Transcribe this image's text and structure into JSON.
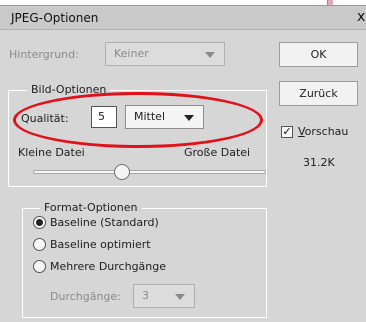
{
  "window": {
    "title": "JPEG-Optionen",
    "close_glyph": "x"
  },
  "hintergrund": {
    "label": "Hintergrund:",
    "value": "Keiner"
  },
  "buttons": {
    "ok": "OK",
    "back": "Zurück"
  },
  "preview": {
    "label_first": "V",
    "label_rest": "orschau",
    "checked": true,
    "size": "31.2K"
  },
  "bild_optionen": {
    "legend": "Bild-Optionen",
    "quality_label": "Qualität:",
    "quality_value": "5",
    "quality_preset": "Mittel",
    "slider_min_label": "Kleine Datei",
    "slider_max_label": "Große Datei"
  },
  "format_optionen": {
    "legend": "Format-Optionen",
    "options": [
      {
        "label": "Baseline (Standard)",
        "selected": true
      },
      {
        "label": "Baseline optimiert",
        "selected": false
      },
      {
        "label": "Mehrere Durchgänge",
        "selected": false
      }
    ],
    "passes_label": "Durchgänge:",
    "passes_value": "3"
  },
  "colors": {
    "highlight_oval": "#e3101a",
    "dialog_bg": "#d6d6d6"
  }
}
